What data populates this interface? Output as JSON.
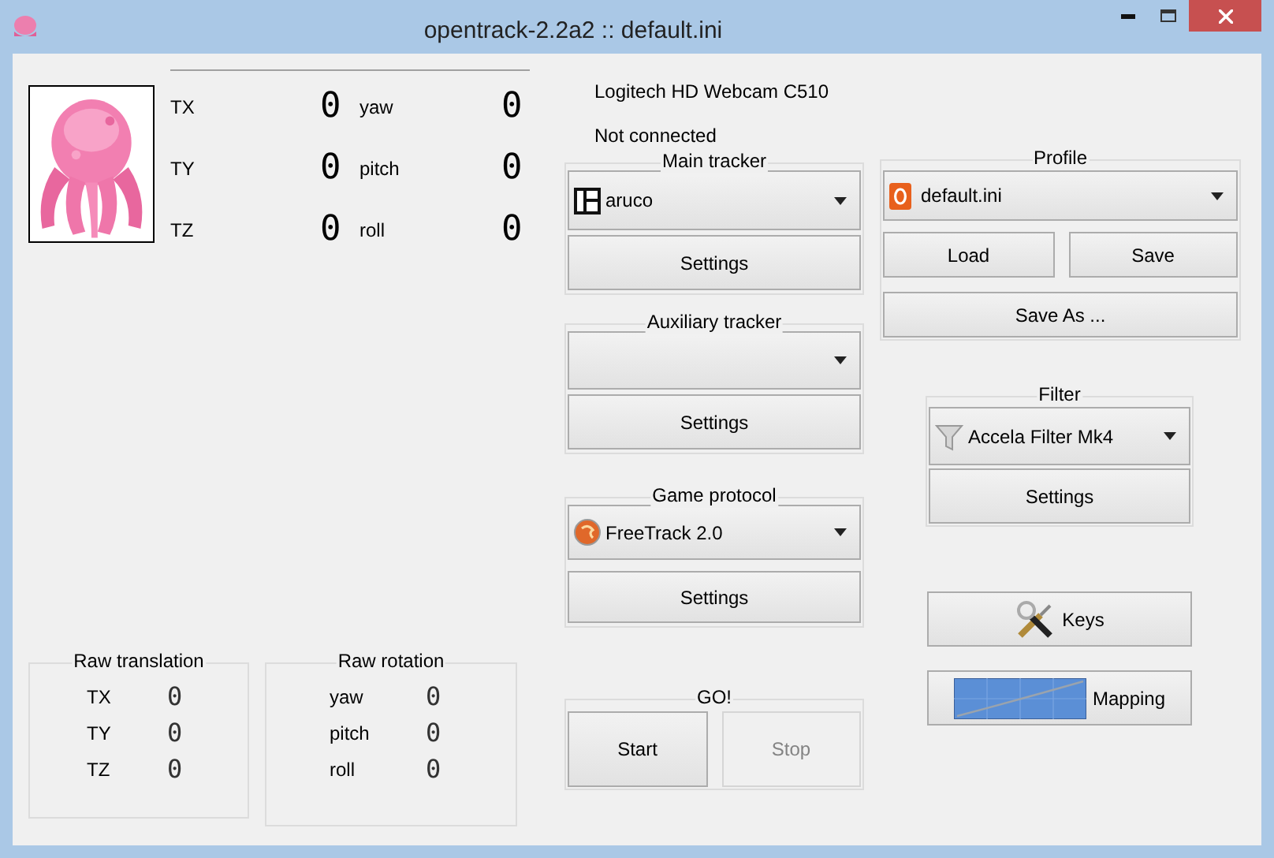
{
  "window": {
    "title": "opentrack-2.2a2 :: default.ini"
  },
  "translation": [
    {
      "label": "TX",
      "value": "0"
    },
    {
      "label": "TY",
      "value": "0"
    },
    {
      "label": "TZ",
      "value": "0"
    }
  ],
  "rotation": [
    {
      "label": "yaw",
      "value": "0"
    },
    {
      "label": "pitch",
      "value": "0"
    },
    {
      "label": "roll",
      "value": "0"
    }
  ],
  "camera": "Logitech HD Webcam C510",
  "status": "Not connected",
  "main_tracker": {
    "title": "Main tracker",
    "selection": "aruco",
    "button": "Settings"
  },
  "auxiliary_tracker": {
    "title": "Auxiliary tracker",
    "button": "Settings"
  },
  "game_protocol": {
    "title": "Game protocol",
    "selection": "FreeTrack 2.0",
    "button": "Settings"
  },
  "go": {
    "title": "GO!",
    "buttons": [
      {
        "label": "Start",
        "disabled": false
      },
      {
        "label": "Stop",
        "disabled": true
      }
    ]
  },
  "profile": {
    "title": "Profile",
    "selection": "default.ini",
    "buttons": [
      "Load",
      "Save",
      "Save As ..."
    ]
  },
  "filter": {
    "title": "Filter",
    "selection": "Accela Filter Mk4",
    "button": "Settings"
  },
  "keys_button": "Keys",
  "mapping_button": "Mapping",
  "raw_translation": {
    "title": "Raw translation",
    "rows": [
      {
        "label": "TX",
        "value": "0"
      },
      {
        "label": "TY",
        "value": "0"
      },
      {
        "label": "TZ",
        "value": "0"
      }
    ]
  },
  "raw_rotation": {
    "title": "Raw rotation",
    "rows": [
      {
        "label": "yaw",
        "value": "0"
      },
      {
        "label": "pitch",
        "value": "0"
      },
      {
        "label": "roll",
        "value": "0"
      }
    ]
  }
}
